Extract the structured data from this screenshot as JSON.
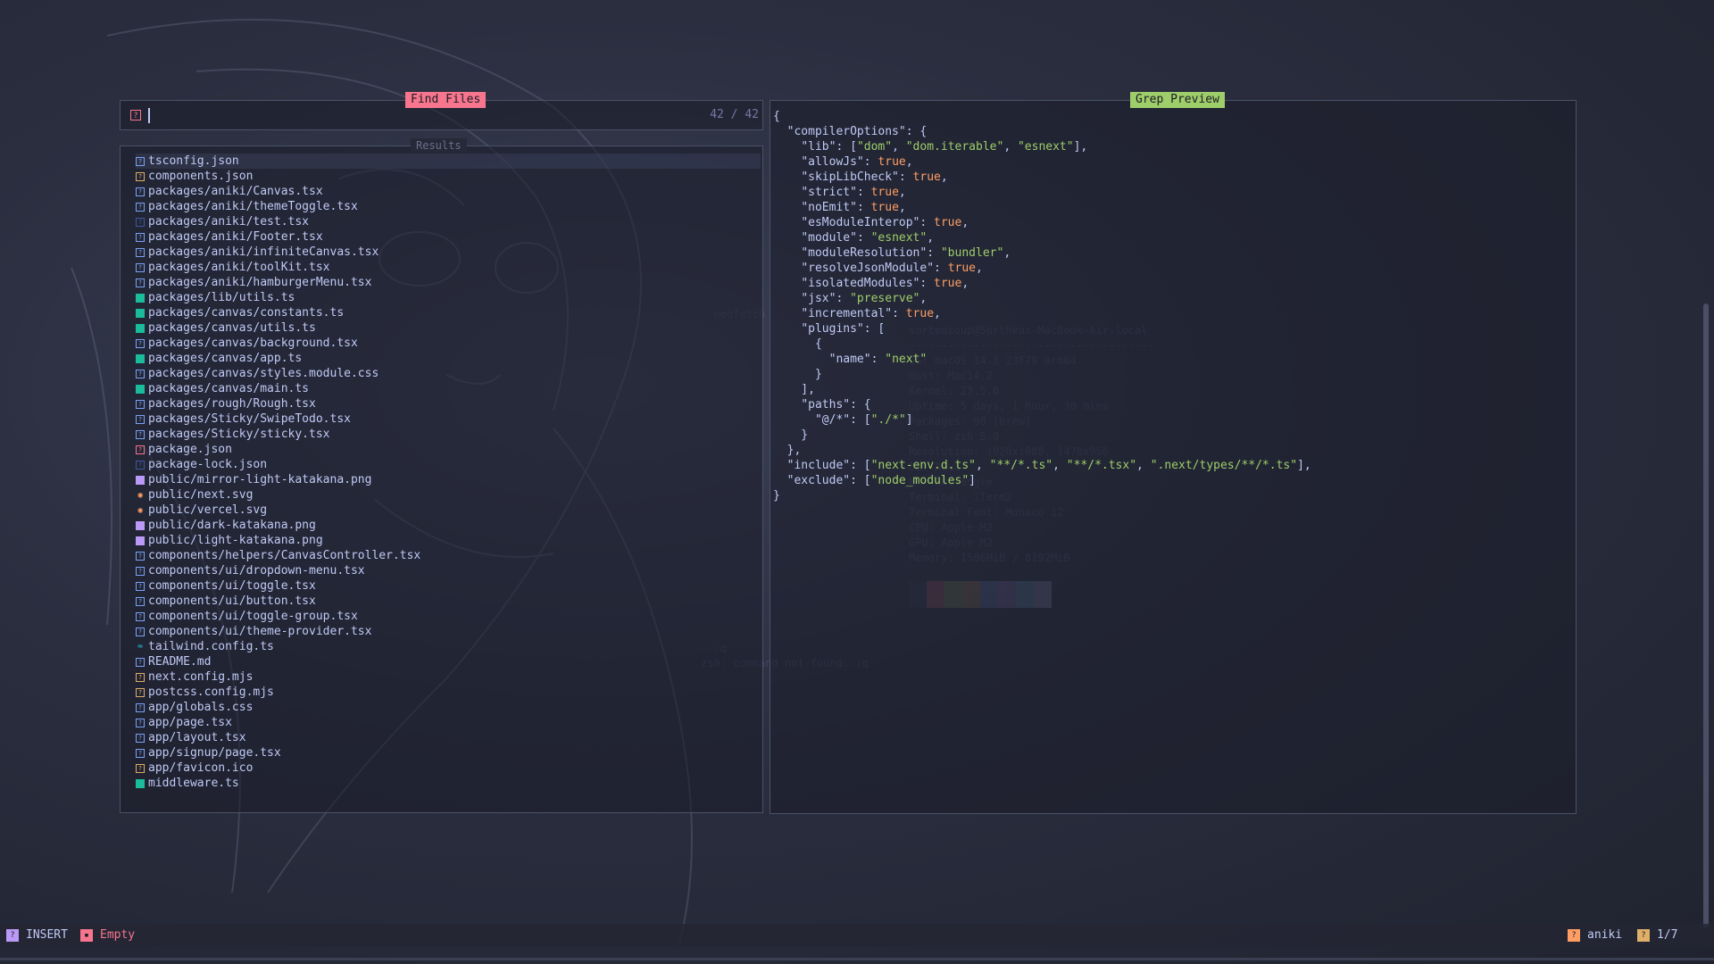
{
  "theme": {
    "accent_pink": "#f7768e",
    "accent_green": "#9ece6a",
    "accent_orange": "#ff9e64",
    "accent_purple": "#bb9af7",
    "accent_blue": "#7aa2f7"
  },
  "prompt": {
    "title": "Find Files",
    "count": "42 / 42",
    "icon": "question-mark-icon"
  },
  "results": {
    "title": "Results",
    "files": [
      {
        "name": "tsconfig.json",
        "icon": "box",
        "color": "#7aa2f7"
      },
      {
        "name": "components.json",
        "icon": "box",
        "color": "#e0af68"
      },
      {
        "name": "packages/aniki/Canvas.tsx",
        "icon": "box",
        "color": "#7aa2f7"
      },
      {
        "name": "packages/aniki/themeToggle.tsx",
        "icon": "box",
        "color": "#7aa2f7"
      },
      {
        "name": "packages/aniki/test.tsx",
        "icon": "box",
        "color": "#3d59a1"
      },
      {
        "name": "packages/aniki/Footer.tsx",
        "icon": "box",
        "color": "#7aa2f7"
      },
      {
        "name": "packages/aniki/infiniteCanvas.tsx",
        "icon": "box",
        "color": "#7aa2f7"
      },
      {
        "name": "packages/aniki/toolKit.tsx",
        "icon": "box",
        "color": "#7aa2f7"
      },
      {
        "name": "packages/aniki/hamburgerMenu.tsx",
        "icon": "box",
        "color": "#7aa2f7"
      },
      {
        "name": "packages/lib/utils.ts",
        "icon": "solid",
        "color": "#1abc9c"
      },
      {
        "name": "packages/canvas/constants.ts",
        "icon": "solid",
        "color": "#1abc9c"
      },
      {
        "name": "packages/canvas/utils.ts",
        "icon": "solid",
        "color": "#1abc9c"
      },
      {
        "name": "packages/canvas/background.tsx",
        "icon": "box",
        "color": "#7aa2f7"
      },
      {
        "name": "packages/canvas/app.ts",
        "icon": "solid",
        "color": "#1abc9c"
      },
      {
        "name": "packages/canvas/styles.module.css",
        "icon": "box",
        "color": "#7aa2f7"
      },
      {
        "name": "packages/canvas/main.ts",
        "icon": "solid",
        "color": "#1abc9c"
      },
      {
        "name": "packages/rough/Rough.tsx",
        "icon": "box",
        "color": "#7aa2f7"
      },
      {
        "name": "packages/Sticky/SwipeTodo.tsx",
        "icon": "box",
        "color": "#7aa2f7"
      },
      {
        "name": "packages/Sticky/sticky.tsx",
        "icon": "box",
        "color": "#7aa2f7"
      },
      {
        "name": "package.json",
        "icon": "box",
        "color": "#f7768e"
      },
      {
        "name": "package-lock.json",
        "icon": "box",
        "color": "#3d59a1"
      },
      {
        "name": "public/mirror-light-katakana.png",
        "icon": "solid",
        "color": "#bb9af7"
      },
      {
        "name": "public/next.svg",
        "icon": "star",
        "color": "#ff9e64"
      },
      {
        "name": "public/vercel.svg",
        "icon": "star",
        "color": "#ff9e64"
      },
      {
        "name": "public/dark-katakana.png",
        "icon": "solid",
        "color": "#bb9af7"
      },
      {
        "name": "public/light-katakana.png",
        "icon": "solid",
        "color": "#bb9af7"
      },
      {
        "name": "components/helpers/CanvasController.tsx",
        "icon": "box",
        "color": "#7aa2f7"
      },
      {
        "name": "components/ui/dropdown-menu.tsx",
        "icon": "box",
        "color": "#7aa2f7"
      },
      {
        "name": "components/ui/toggle.tsx",
        "icon": "box",
        "color": "#7aa2f7"
      },
      {
        "name": "components/ui/button.tsx",
        "icon": "box",
        "color": "#7aa2f7"
      },
      {
        "name": "components/ui/toggle-group.tsx",
        "icon": "box",
        "color": "#7aa2f7"
      },
      {
        "name": "components/ui/theme-provider.tsx",
        "icon": "box",
        "color": "#7aa2f7"
      },
      {
        "name": "tailwind.config.ts",
        "icon": "wave",
        "color": "#2ac3de"
      },
      {
        "name": "README.md",
        "icon": "box",
        "color": "#7aa2f7"
      },
      {
        "name": "next.config.mjs",
        "icon": "box",
        "color": "#e0af68"
      },
      {
        "name": "postcss.config.mjs",
        "icon": "box",
        "color": "#e0af68"
      },
      {
        "name": "app/globals.css",
        "icon": "box",
        "color": "#7aa2f7"
      },
      {
        "name": "app/page.tsx",
        "icon": "box",
        "color": "#7aa2f7"
      },
      {
        "name": "app/layout.tsx",
        "icon": "box",
        "color": "#7aa2f7"
      },
      {
        "name": "app/signup/page.tsx",
        "icon": "box",
        "color": "#7aa2f7"
      },
      {
        "name": "app/favicon.ico",
        "icon": "box",
        "color": "#e0af68"
      },
      {
        "name": "middleware.ts",
        "icon": "solid",
        "color": "#1abc9c"
      }
    ]
  },
  "preview": {
    "title": "Grep Preview",
    "lines": [
      [
        [
          "p",
          "{"
        ]
      ],
      [
        [
          "p",
          "  "
        ],
        [
          "k",
          "\"compilerOptions\""
        ],
        [
          "p",
          ": {"
        ]
      ],
      [
        [
          "p",
          "    "
        ],
        [
          "k",
          "\"lib\""
        ],
        [
          "p",
          ": ["
        ],
        [
          "s",
          "\"dom\""
        ],
        [
          "p",
          ", "
        ],
        [
          "s",
          "\"dom.iterable\""
        ],
        [
          "p",
          ", "
        ],
        [
          "s",
          "\"esnext\""
        ],
        [
          "p",
          "],"
        ]
      ],
      [
        [
          "p",
          "    "
        ],
        [
          "k",
          "\"allowJs\""
        ],
        [
          "p",
          ": "
        ],
        [
          "b",
          "true"
        ],
        [
          "p",
          ","
        ]
      ],
      [
        [
          "p",
          "    "
        ],
        [
          "k",
          "\"skipLibCheck\""
        ],
        [
          "p",
          ": "
        ],
        [
          "b",
          "true"
        ],
        [
          "p",
          ","
        ]
      ],
      [
        [
          "p",
          "    "
        ],
        [
          "k",
          "\"strict\""
        ],
        [
          "p",
          ": "
        ],
        [
          "b",
          "true"
        ],
        [
          "p",
          ","
        ]
      ],
      [
        [
          "p",
          "    "
        ],
        [
          "k",
          "\"noEmit\""
        ],
        [
          "p",
          ": "
        ],
        [
          "b",
          "true"
        ],
        [
          "p",
          ","
        ]
      ],
      [
        [
          "p",
          "    "
        ],
        [
          "k",
          "\"esModuleInterop\""
        ],
        [
          "p",
          ": "
        ],
        [
          "b",
          "true"
        ],
        [
          "p",
          ","
        ]
      ],
      [
        [
          "p",
          "    "
        ],
        [
          "k",
          "\"module\""
        ],
        [
          "p",
          ": "
        ],
        [
          "s",
          "\"esnext\""
        ],
        [
          "p",
          ","
        ]
      ],
      [
        [
          "p",
          "    "
        ],
        [
          "k",
          "\"moduleResolution\""
        ],
        [
          "p",
          ": "
        ],
        [
          "s",
          "\"bundler\""
        ],
        [
          "p",
          ","
        ]
      ],
      [
        [
          "p",
          "    "
        ],
        [
          "k",
          "\"resolveJsonModule\""
        ],
        [
          "p",
          ": "
        ],
        [
          "b",
          "true"
        ],
        [
          "p",
          ","
        ]
      ],
      [
        [
          "p",
          "    "
        ],
        [
          "k",
          "\"isolatedModules\""
        ],
        [
          "p",
          ": "
        ],
        [
          "b",
          "true"
        ],
        [
          "p",
          ","
        ]
      ],
      [
        [
          "p",
          "    "
        ],
        [
          "k",
          "\"jsx\""
        ],
        [
          "p",
          ": "
        ],
        [
          "s",
          "\"preserve\""
        ],
        [
          "p",
          ","
        ]
      ],
      [
        [
          "p",
          "    "
        ],
        [
          "k",
          "\"incremental\""
        ],
        [
          "p",
          ": "
        ],
        [
          "b",
          "true"
        ],
        [
          "p",
          ","
        ]
      ],
      [
        [
          "p",
          "    "
        ],
        [
          "k",
          "\"plugins\""
        ],
        [
          "p",
          ": ["
        ]
      ],
      [
        [
          "p",
          "      {"
        ]
      ],
      [
        [
          "p",
          "        "
        ],
        [
          "k",
          "\"name\""
        ],
        [
          "p",
          ": "
        ],
        [
          "s",
          "\"next\""
        ]
      ],
      [
        [
          "p",
          "      }"
        ]
      ],
      [
        [
          "p",
          "    ],"
        ]
      ],
      [
        [
          "p",
          "    "
        ],
        [
          "k",
          "\"paths\""
        ],
        [
          "p",
          ": {"
        ]
      ],
      [
        [
          "p",
          "      "
        ],
        [
          "k",
          "\"@/*\""
        ],
        [
          "p",
          ": ["
        ],
        [
          "s",
          "\"./*\""
        ],
        [
          "p",
          "]"
        ]
      ],
      [
        [
          "p",
          "    }"
        ]
      ],
      [
        [
          "p",
          "  },"
        ]
      ],
      [
        [
          "p",
          "  "
        ],
        [
          "k",
          "\"include\""
        ],
        [
          "p",
          ": ["
        ],
        [
          "s",
          "\"next-env.d.ts\""
        ],
        [
          "p",
          ", "
        ],
        [
          "s",
          "\"**/*.ts\""
        ],
        [
          "p",
          ", "
        ],
        [
          "s",
          "\"**/*.tsx\""
        ],
        [
          "p",
          ", "
        ],
        [
          "s",
          "\".next/types/**/*.ts\""
        ],
        [
          "p",
          "],"
        ]
      ],
      [
        [
          "p",
          "  "
        ],
        [
          "k",
          "\"exclude\""
        ],
        [
          "p",
          ": ["
        ],
        [
          "s",
          "\"node_modules\""
        ],
        [
          "p",
          "]"
        ]
      ],
      [
        [
          "p",
          "}"
        ]
      ]
    ]
  },
  "statusbar": {
    "mode": "INSERT",
    "mode_icon": "vim-mode-icon",
    "buffer": "Empty",
    "buffer_icon": "buffer-icon",
    "project": "aniki",
    "project_icon": "folder-icon",
    "position": "1/7",
    "position_icon": "cursor-position-icon"
  }
}
